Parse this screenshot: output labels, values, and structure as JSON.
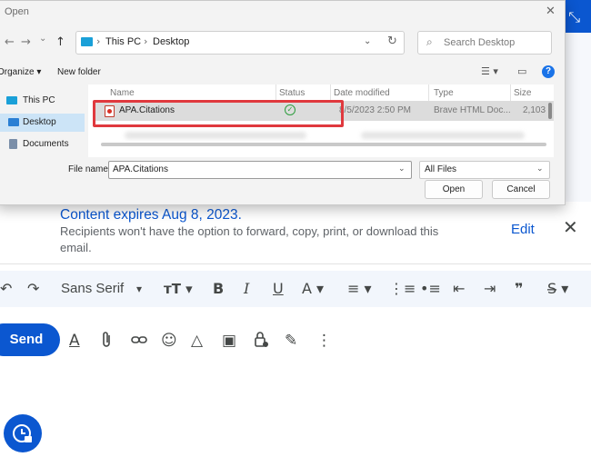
{
  "dialog": {
    "title": "Open",
    "close_glyph": "✕",
    "nav": {
      "back": "←",
      "forward": "→",
      "recent": "⌄",
      "up": "↑"
    },
    "address": {
      "segments": [
        "This PC",
        "Desktop"
      ],
      "sep": "›",
      "chevron": "⌄",
      "refresh": "↻"
    },
    "search": {
      "placeholder": "Search Desktop",
      "icon": "⌕"
    },
    "toolbar": {
      "organize": "Organize ▾",
      "new_folder": "New folder",
      "view": "☰ ▾",
      "pane": "▭",
      "help": "?"
    },
    "nav_pane": [
      {
        "label": "This PC",
        "icon_color": "#1aa0d8",
        "selected": false
      },
      {
        "label": "Desktop",
        "icon_color": "#2a7fd4",
        "selected": true
      },
      {
        "label": "Documents",
        "icon_color": "#7a8ea8",
        "selected": false
      }
    ],
    "columns": [
      "Name",
      "Status",
      "Date modified",
      "Type",
      "Size"
    ],
    "files": [
      {
        "name": "APA.Citations",
        "status": "✓",
        "date": "8/5/2023 2:50 PM",
        "type": "Brave HTML Doc...",
        "size": "2,103"
      }
    ],
    "file_name_label": "File name:",
    "file_name_value": "APA.Citations",
    "filter": "All Files",
    "open_button": "Open",
    "cancel_button": "Cancel"
  },
  "gmail": {
    "minimize_glyph": "⤡",
    "notice": {
      "title": "Content expires Aug 8, 2023.",
      "body": "Recipients won't have the option to forward, copy, print, or download this email.",
      "edit": "Edit",
      "close": "✕"
    },
    "format": {
      "undo": "↶",
      "redo": "↷",
      "font": "Sans Serif",
      "font_chev": "▾",
      "size": "тT ▾",
      "bold": "B",
      "italic": "I",
      "underline": "U",
      "text_color": "A ▾",
      "align": "≡ ▾",
      "numbered": "⋮≡",
      "bulleted": "•≡",
      "indent_less": "⇤",
      "indent_more": "⇥",
      "quote": "❞",
      "strike": "S̶ ▾"
    },
    "compose": {
      "send": "Send",
      "tools": [
        "A",
        "⌂",
        "⊘",
        "☺",
        "△",
        "▣",
        "⊛",
        "✎",
        "⋮"
      ]
    }
  }
}
